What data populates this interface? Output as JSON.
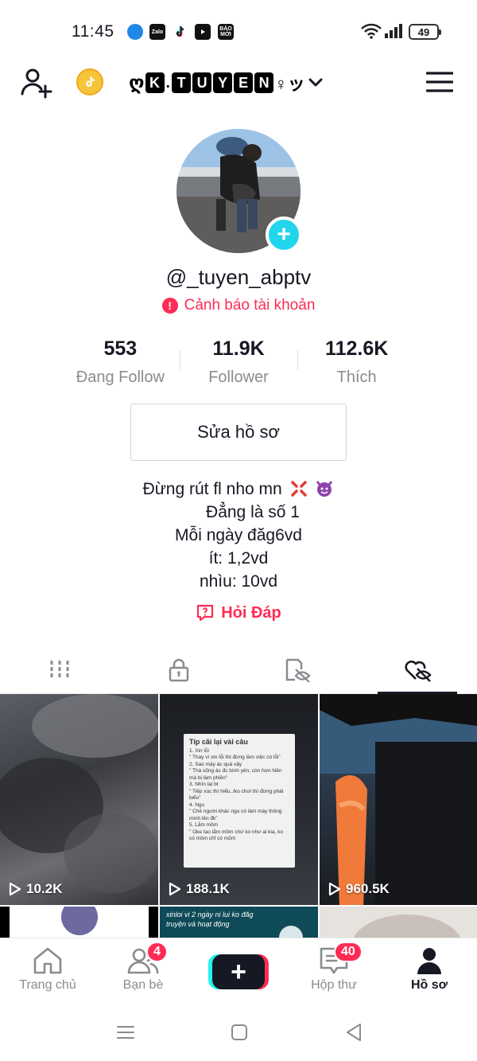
{
  "status_bar": {
    "time": "11:45",
    "apps": [
      {
        "name": "messenger-app-icon",
        "label": "",
        "color": "#1e88e5"
      },
      {
        "name": "zalo-app-icon",
        "label": "Zalo",
        "color": "#0068ff"
      },
      {
        "name": "tiktok-app-icon",
        "label": "",
        "color": "#111111"
      },
      {
        "name": "youtube-app-icon",
        "label": "",
        "color": "#111111"
      },
      {
        "name": "baomoi-app-icon",
        "label": "BÁO MỚI",
        "color": "#111111"
      }
    ],
    "battery": "49"
  },
  "header": {
    "username_prefix": "ღ",
    "username_boxes": [
      "K",
      "T",
      "U",
      "Y",
      "E",
      "N"
    ],
    "username_suffix": "♀ッ"
  },
  "profile": {
    "handle": "@_tuyen_abptv",
    "warning": "Cảnh báo tài khoản",
    "stats": [
      {
        "value": "553",
        "label": "Đang Follow"
      },
      {
        "value": "11.9K",
        "label": "Follower"
      },
      {
        "value": "112.6K",
        "label": "Thích"
      }
    ],
    "edit_button": "Sửa hồ sơ",
    "bio": [
      "Đừng rút fl nho mn",
      "Đẳng là số 1",
      "Mỗi ngày đăg6vd",
      "ít: 1,2vd",
      "nhìu: 10vd"
    ],
    "qa_label": "Hỏi Đáp"
  },
  "tabs": [
    {
      "name": "videos-tab",
      "icon": "grid-icon",
      "active": false
    },
    {
      "name": "private-tab",
      "icon": "lock-icon",
      "active": false
    },
    {
      "name": "hidden-tab",
      "icon": "hidden-icon",
      "active": false
    },
    {
      "name": "liked-tab",
      "icon": "liked-hidden-icon",
      "active": true
    }
  ],
  "videos": [
    {
      "views": "10.2K"
    },
    {
      "views": "188.1K"
    },
    {
      "views": "960.5K"
    }
  ],
  "video2_note": {
    "title": "Tip cãi lại vài câu",
    "lines": [
      "1. Xin lỗi",
      "\" Thay vì xin lỗi thì đừng làm việc có lỗi\"",
      "2. Sao máy ác quá vậy",
      "\" Thà sống ác đc bình yên, còn hơn hiền mà bị làm phiền\"",
      "3. Nhìn lại bt",
      "\" Tiếp xúc thì hiểu../ko chơi thì đừng phát biểu\"",
      "4. Ngu",
      "\" Chê người khác ngu có làm máy thông minh lên đk\"",
      "5. Lắm mồm",
      "\" Oke tao lắm mồm chứ ko như ai kia, ko có mồm chỉ có mõm"
    ]
  },
  "video5_caption": "xinloi vi 2 ngày ni lui ko đăg truyện và hoạt động",
  "bottom_nav": [
    {
      "label": "Trang chủ",
      "icon": "home-icon",
      "badge": ""
    },
    {
      "label": "Bạn bè",
      "icon": "friends-icon",
      "badge": "4"
    },
    {
      "label": "",
      "icon": "create-icon",
      "badge": ""
    },
    {
      "label": "Hộp thư",
      "icon": "inbox-icon",
      "badge": "40"
    },
    {
      "label": "Hồ sơ",
      "icon": "profile-icon",
      "badge": "",
      "active": true
    }
  ],
  "colors": {
    "accent": "#fe2c55",
    "cyan": "#20d5ec",
    "text": "#161823",
    "muted": "#8a8b91"
  }
}
